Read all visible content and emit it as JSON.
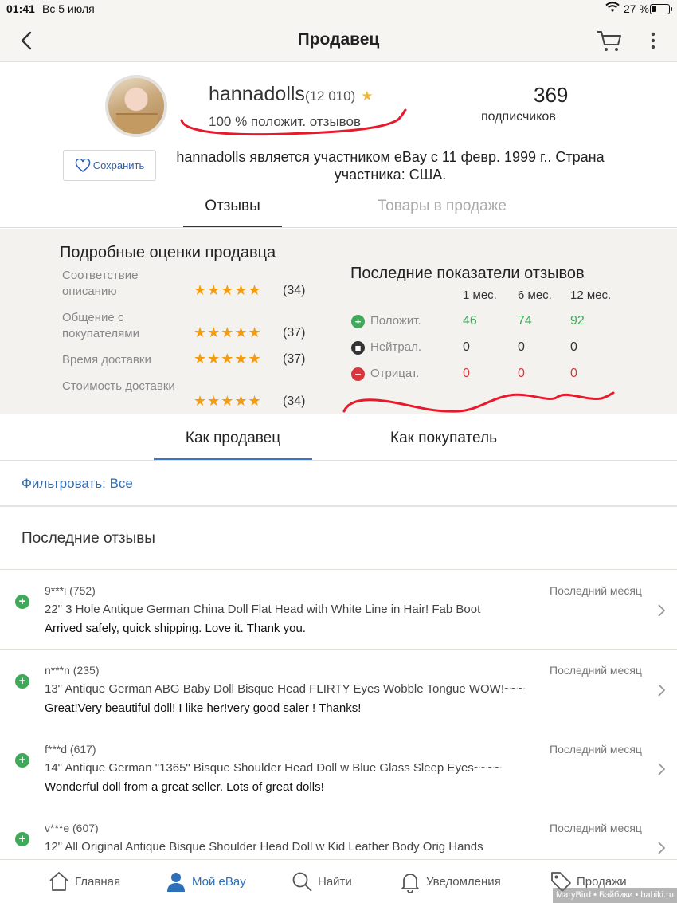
{
  "status_bar": {
    "time": "01:41",
    "date": "Вс 5 июля",
    "battery": "27 %",
    "battery_level": 0.27
  },
  "nav": {
    "title": "Продавец"
  },
  "profile": {
    "username": "hannadolls",
    "feedback_count": "(12 010)",
    "positive_feedback": "100 % положит. отзывов",
    "followers_count": "369",
    "followers_label": "подписчиков",
    "save_label": "Сохранить",
    "member_info": "hannadolls является участником eBay с 11 февр. 1999 г.. Страна участника: США."
  },
  "tabs": {
    "reviews": "Отзывы",
    "items_for_sale": "Товары в продаже"
  },
  "detailed_ratings": {
    "title": "Подробные оценки продавца",
    "rows": [
      {
        "label": "Соответствие описанию",
        "stars": 5,
        "count": "(34)"
      },
      {
        "label": "Общение с покупателями",
        "stars": 5,
        "count": "(37)"
      },
      {
        "label": "Время доставки",
        "stars": 5,
        "count": "(37)"
      },
      {
        "label": "Стоимость доставки",
        "stars": 5,
        "count": "(34)"
      }
    ]
  },
  "recent_ratings": {
    "title": "Последние показатели отзывов",
    "columns": [
      "1 мес.",
      "6 мес.",
      "12 мес."
    ],
    "rows": [
      {
        "label": "Положит.",
        "icon": "plus-icon",
        "values": [
          "46",
          "74",
          "92"
        ],
        "color": "#3fa95a"
      },
      {
        "label": "Нейтрал.",
        "icon": "neutral-icon",
        "values": [
          "0",
          "0",
          "0"
        ],
        "color": "#333333"
      },
      {
        "label": "Отрицат.",
        "icon": "minus-icon",
        "values": [
          "0",
          "0",
          "0"
        ],
        "color": "#d9363e"
      }
    ]
  },
  "role_tabs": {
    "seller": "Как продавец",
    "buyer": "Как покупатель"
  },
  "filter": "Фильтровать: Все",
  "recent_feedback_title": "Последние отзывы",
  "feedback": [
    {
      "user": "9***i (752)",
      "item": "22\" 3 Hole Antique German China Doll Flat Head with White Line in Hair! Fab Boot",
      "comment": "Arrived safely, quick shipping. Love it.  Thank you.",
      "when": "Последний месяц"
    },
    {
      "user": "n***n (235)",
      "item": "13\" Antique German ABG Baby Doll Bisque Head FLIRTY Eyes Wobble Tongue WOW!~~~",
      "comment": "Great!Very beautiful doll! I like her!very good saler ! Thanks!",
      "when": "Последний месяц"
    },
    {
      "user": "f***d (617)",
      "item": "14\" Antique German \"1365\" Bisque Shoulder Head Doll w Blue Glass Sleep Eyes~~~~",
      "comment": "Wonderful doll from a great seller.  Lots of great dolls!",
      "when": "Последний месяц"
    },
    {
      "user": "v***e (607)",
      "item": "12\" All Original Antique Bisque Shoulder Head Doll w Kid Leather Body Orig Hands",
      "comment": "",
      "when": "Последний месяц"
    }
  ],
  "bottom_nav": {
    "home": "Главная",
    "my_ebay": "Мой eBay",
    "search": "Найти",
    "notifications": "Уведомления",
    "selling": "Продажи"
  },
  "watermark": "MaryBird • Бэйбики • babiki.ru",
  "colors": {
    "accent": "#2d6fb8",
    "positive": "#3fa95a",
    "negative": "#d9363e",
    "star": "#f39c12",
    "annotation": "#e8192c"
  }
}
